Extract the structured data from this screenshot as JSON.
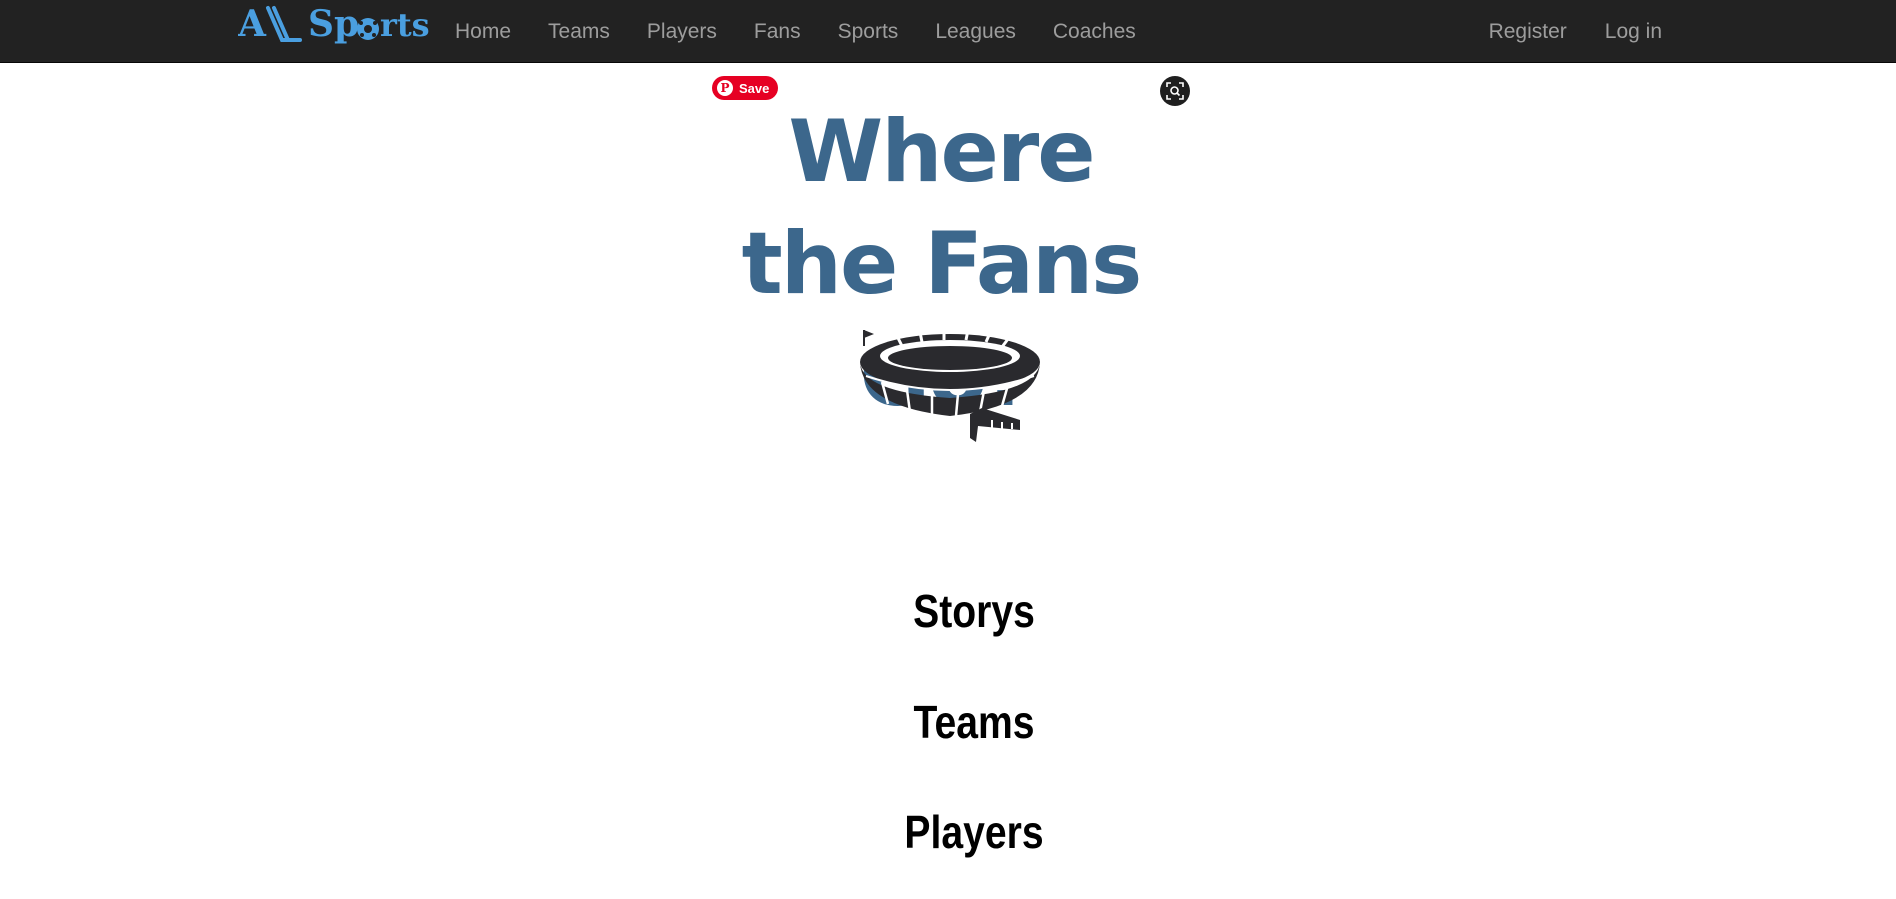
{
  "navbar": {
    "brand": "All Sports",
    "left_links": [
      "Home",
      "Teams",
      "Players",
      "Fans",
      "Sports",
      "Leagues",
      "Coaches"
    ],
    "right_links": [
      "Register",
      "Log in"
    ]
  },
  "hero": {
    "title": "Where the Fans Go!",
    "pinterest_save_label": "Save",
    "brand_color": "#3c678c"
  },
  "sections": [
    "Storys",
    "Teams",
    "Players"
  ],
  "colors": {
    "navbar_bg": "#222222",
    "nav_link": "#9d9d9d",
    "brand": "#4a9fe0",
    "pinterest": "#e60023"
  }
}
